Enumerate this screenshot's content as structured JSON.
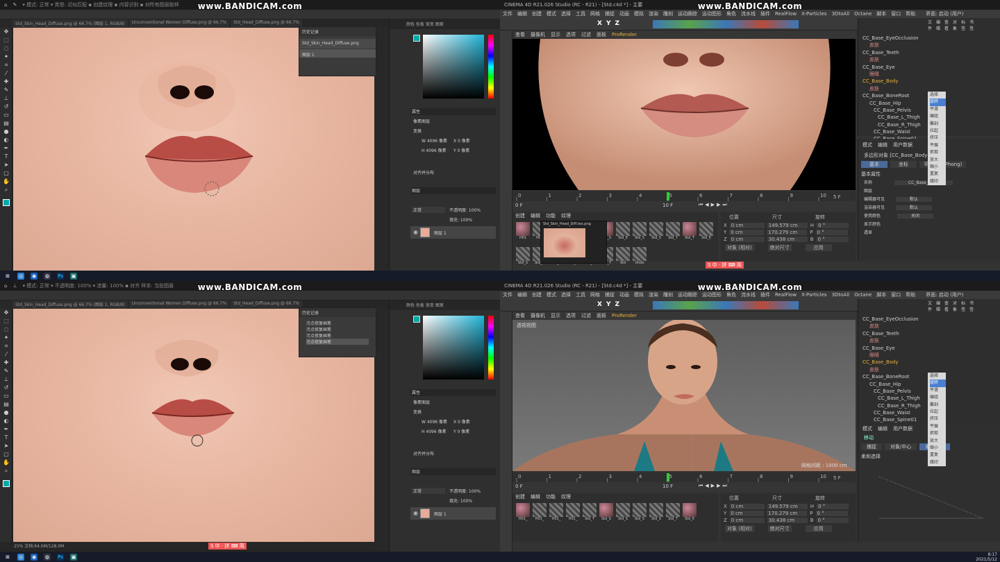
{
  "watermark": "www.BANDICAM.com",
  "photoshop": {
    "tabs": [
      "Std_Skin_Head_Diffuse.png @ 66.7% (图层 1, RGB/8)",
      "Unconventional Women Diffuse.png @ 66.7%",
      "Std_Head_Diffuse.png @ 66.7%"
    ],
    "status": "25% 文档:64.0M/128.0M",
    "layer_popup_title": "历史记录",
    "layer_popup_items_top": [
      "Std_Skin_Head_Diffuse.png",
      "图层 1"
    ],
    "layer_popup_items_bottom": [
      "污点修复画笔",
      "污点修复画笔",
      "污点修复画笔",
      "污点修复画笔"
    ],
    "props_title": "属性",
    "props_sub": "像素图层",
    "transform_label": "变换",
    "w_label": "W 4096 像素",
    "h_label": "H 4096 像素",
    "x_label": "X 0 像素",
    "y_label": "Y 0 像素",
    "align_label": "对齐并分布",
    "layers_title": "图层",
    "blend_mode": "正常",
    "opacity": "不透明度: 100%",
    "fill": "填充: 100%",
    "layer_name": "图层 1"
  },
  "c4d": {
    "title": "CINEMA 4D R21.026 Studio (RC - R21) - [Std.c4d *] - 主要",
    "menus": [
      "文件",
      "编辑",
      "创建",
      "模式",
      "选择",
      "工具",
      "网格",
      "捕捉",
      "动画",
      "模拟",
      "渲染",
      "雕刻",
      "运动跟踪",
      "运动图形",
      "角色",
      "流水线",
      "插件",
      "RealFlow",
      "X-Particles",
      "3DtoAll",
      "Octane",
      "脚本",
      "窗口",
      "帮助"
    ],
    "interface": "界面: 启动 (用户)",
    "view_menus": [
      "查看",
      "摄像机",
      "显示",
      "选项",
      "过滤",
      "面板",
      "ProRender"
    ],
    "view_label_bottom": "透视视图",
    "grid_text": "网格间距 : 1000 cm",
    "timeline_ticks": [
      "0",
      "1",
      "2",
      "3",
      "4",
      "5",
      "6",
      "7",
      "8",
      "9",
      "10"
    ],
    "frame_current": "0 F",
    "frame_end": "10 F",
    "time_readout": "00:00:00",
    "frame_tick_end": "5 F",
    "objects": [
      "CC_Base_EyeOcclusion",
      "皮肤",
      "CC_Base_Teeth",
      "皮肤",
      "CC_Base_Eye",
      "眼睛",
      "CC_Base_Body",
      "皮肤",
      "CC_Base_BoneRoot",
      "CC_Base_Hip",
      "CC_Base_Pelvis",
      "CC_Base_L_Thigh",
      "CC_Base_R_Thigh",
      "CC_Base_Waist",
      "CC_Base_Spine01"
    ],
    "obj_tabs": [
      "文件",
      "编辑",
      "查看",
      "对象",
      "标签",
      "书签"
    ],
    "attr_tabs": [
      "模式",
      "编辑",
      "用户数据"
    ],
    "attr_title": "多边形对象 [CC_Base_Body]",
    "attr_basic": "基本",
    "attr_coord": "坐标",
    "attr_phong": "平滑着色(Phong)",
    "attr_props": "基本属性",
    "attr_name_label": "名称",
    "attr_name_value": "CC_Base_Body",
    "attr_layer_label": "图层",
    "attr_editor_vis": "编辑器可见",
    "attr_render_vis": "渲染器可见",
    "attr_use_color": "使用颜色",
    "attr_show_color": "显示颜色",
    "attr_xray": "透显",
    "attr_default1": "默认",
    "attr_default2": "默认",
    "attr_off": "关闭",
    "attr_bottom_title": "移动",
    "attr_bottom_tabs": [
      "捕捉",
      "对象/中心",
      "柔和选择"
    ],
    "attr_bottom_sub": "柔和选择",
    "context_menu": [
      "选择",
      "旋转",
      "平滑",
      "编组",
      "雕刻",
      "拉起",
      "挤压",
      "平展",
      "抓取",
      "放大",
      "缩小",
      "重复",
      "蜡印"
    ],
    "mat_tabs": [
      "创建",
      "编辑",
      "功能",
      "纹理"
    ],
    "mat_names_top": [
      "H01",
      "H01",
      "Std_S",
      "Std_S",
      "Std_S",
      "Std_S",
      "Std_E",
      "Std_S",
      "Std_S",
      "Std_T",
      "Std_T",
      "Std_E",
      "Std_S",
      "Std_S",
      "Std_S",
      "Std_E",
      "Std_T",
      "Std_T",
      "Std",
      "Unde"
    ],
    "mat_names_bottom": [
      "H01_",
      "H01_",
      "H01_",
      "H01_",
      "Std_T",
      "Std_S",
      "Std_S",
      "Std_S",
      "Std_S",
      "Std_T",
      "Std_E"
    ],
    "coords_headers": [
      "位置",
      "尺寸",
      "旋转"
    ],
    "coords_rows": [
      {
        "axis": "X",
        "pos": "0 cm",
        "size": "149.579 cm",
        "rot_label": "H",
        "rot": "0 °"
      },
      {
        "axis": "Y",
        "pos": "0 cm",
        "size": "170.279 cm",
        "rot_label": "P",
        "rot": "0 °"
      },
      {
        "axis": "Z",
        "pos": "0 cm",
        "size": "30.438 cm",
        "rot_label": "B",
        "rot": "0 °"
      }
    ],
    "coords_mode": "对象 (相对)",
    "coords_size_mode": "绝对尺寸",
    "coords_apply": "应用",
    "tex_popup": "Std_Skin_Head_Diff.tex.png"
  },
  "taskbar": {
    "time": "8:17",
    "date": "2021/5/12",
    "ime": "S 中 · 拼 ⌨ 简"
  }
}
